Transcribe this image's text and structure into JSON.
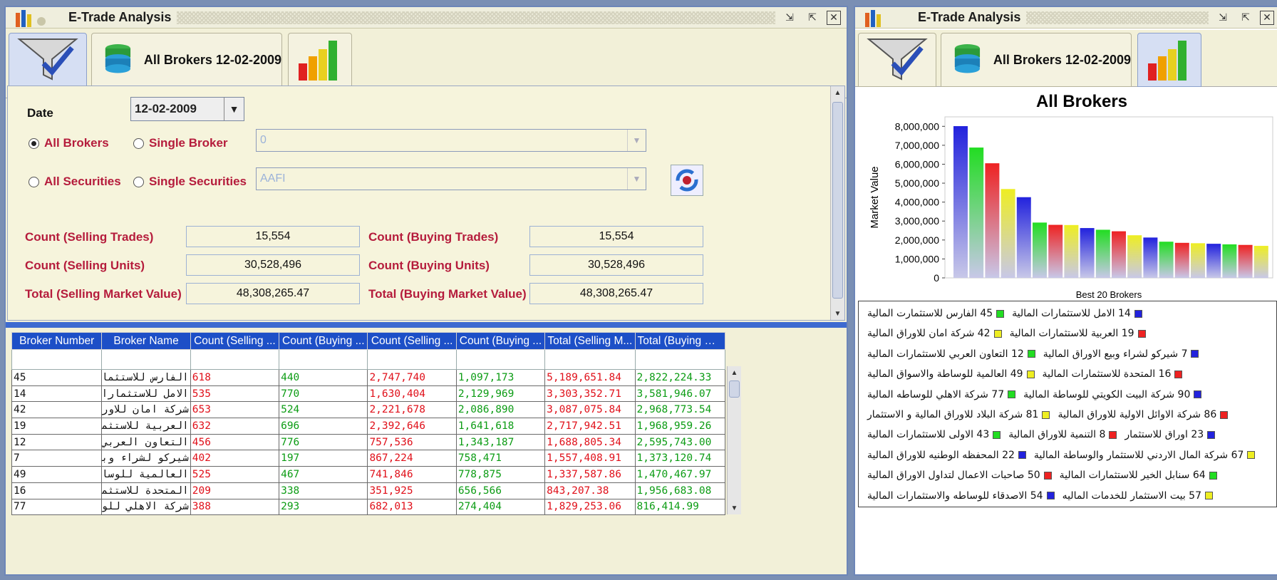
{
  "left_window": {
    "title": "E-Trade Analysis",
    "controls": {
      "minimize": "⇲",
      "maximize": "⇱",
      "close": "✕"
    },
    "tabs": [
      {
        "icon": "filter-icon",
        "label": ""
      },
      {
        "icon": "database-icon",
        "label": "All Brokers  12-02-2009"
      },
      {
        "icon": "bar-chart-icon",
        "label": ""
      }
    ],
    "form": {
      "date_label": "Date",
      "date_value": "12-02-2009",
      "all_brokers": "All Brokers",
      "single_broker": "Single Broker",
      "broker_value": "0",
      "all_securities": "All Securities",
      "single_securities": "Single Securities",
      "security_value": "AAFI"
    },
    "stats": {
      "count_selling_trades_label": "Count (Selling Trades)",
      "count_selling_trades": "15,554",
      "count_buying_trades_label": "Count (Buying Trades)",
      "count_buying_trades": "15,554",
      "count_selling_units_label": "Count (Selling Units)",
      "count_selling_units": "30,528,496",
      "count_buying_units_label": "Count (Buying Units)",
      "count_buying_units": "30,528,496",
      "total_selling_label": "Total (Selling Market Value)",
      "total_selling": "48,308,265.47",
      "total_buying_label": "Total (Buying Market Value)",
      "total_buying": "48,308,265.47"
    },
    "table": {
      "headers": [
        "Broker Number",
        "Broker Name",
        "Count (Selling ...",
        "Count (Buying ...",
        "Count (Selling ...",
        "Count (Buying ...",
        "Total (Selling M...",
        "Total (Buying M..."
      ],
      "rows": [
        [
          "45",
          "الفارس للاستثمارت ...",
          "618",
          "440",
          "2,747,740",
          "1,097,173",
          "5,189,651.84",
          "2,822,224.33"
        ],
        [
          "14",
          "الامل للاستثمارات ...",
          "535",
          "770",
          "1,630,404",
          "2,129,969",
          "3,303,352.71",
          "3,581,946.07"
        ],
        [
          "42",
          "شركة امان للاوراق ...",
          "653",
          "524",
          "2,221,678",
          "2,086,890",
          "3,087,075.84",
          "2,968,773.54"
        ],
        [
          "19",
          "العربية للاستثمارات ...",
          "632",
          "696",
          "2,392,646",
          "1,641,618",
          "2,717,942.51",
          "1,968,959.26"
        ],
        [
          "12",
          "التعاون العربي ...",
          "456",
          "776",
          "757,536",
          "1,343,187",
          "1,688,805.34",
          "2,595,743.00"
        ],
        [
          "7",
          "شيركو لشراء وبيع ...",
          "402",
          "197",
          "867,224",
          "758,471",
          "1,557,408.91",
          "1,373,120.74"
        ],
        [
          "49",
          "العالمية للوساطة ...",
          "525",
          "467",
          "741,846",
          "778,875",
          "1,337,587.86",
          "1,470,467.97"
        ],
        [
          "16",
          "المتحدة للاستثمارات ...",
          "209",
          "338",
          "351,925",
          "656,566",
          "843,207.38",
          "1,956,683.08"
        ],
        [
          "77",
          "شركة الاهلي للوساطه ...",
          "388",
          "293",
          "682,013",
          "274,404",
          "1,829,253.06",
          "816,414.99"
        ]
      ]
    }
  },
  "right_window": {
    "title": "E-Trade Analysis",
    "controls": {
      "minimize": "⇲",
      "maximize": "⇱",
      "close": "✕"
    },
    "tab_label": "All Brokers  12-02-2009",
    "legend": [
      [
        {
          "n": "14 الامل للاستثمارات المالية",
          "c": "#2222dd"
        },
        {
          "n": "45 الفارس للاستثمارت المالية",
          "c": "#22dd22"
        }
      ],
      [
        {
          "n": "19 العربية للاستثمارات المالية",
          "c": "#ee2222"
        },
        {
          "n": "42 شركة امان للاوراق المالية",
          "c": "#eeee22"
        }
      ],
      [
        {
          "n": "7 شيركو لشراء وبيع الاوراق المالية",
          "c": "#2222dd"
        },
        {
          "n": "12 التعاون العربي للاستثمارات المالية",
          "c": "#22dd22"
        }
      ],
      [
        {
          "n": "16 المتحدة للاستثمارات المالية",
          "c": "#ee2222"
        },
        {
          "n": "49 العالمية للوساطة والاسواق المالية",
          "c": "#eeee22"
        }
      ],
      [
        {
          "n": "90 شركة البيت الكويتي للوساطة المالية",
          "c": "#2222dd"
        },
        {
          "n": "77 شركة الاهلي للوساطه المالية",
          "c": "#22dd22"
        }
      ],
      [
        {
          "n": "86 شركة الاوائل الاولية للاوراق المالية",
          "c": "#ee2222"
        },
        {
          "n": "81 شركة البلاد للاوراق المالية و الاستثمار",
          "c": "#eeee22"
        }
      ],
      [
        {
          "n": "23 اوراق للاستثمار",
          "c": "#2222dd"
        },
        {
          "n": "8 التنمية للاوراق المالية",
          "c": "#ee2222"
        },
        {
          "n": "43 الاولى للاستثمارات المالية",
          "c": "#22dd22"
        }
      ],
      [
        {
          "n": "67 شركة المال الاردني للاستثمار والوساطة المالية",
          "c": "#eeee22"
        },
        {
          "n": "22 المحفظه الوطنيه للاوراق المالية",
          "c": "#2222dd"
        }
      ],
      [
        {
          "n": "64 سنابل الخير للاستثمارات المالية",
          "c": "#22dd22"
        },
        {
          "n": "50 صاحبات الاعمال لتداول الاوراق المالية",
          "c": "#ee2222"
        }
      ],
      [
        {
          "n": "57 بيت الاستثمار للخدمات الماليه",
          "c": "#eeee22"
        },
        {
          "n": "54 الاصدقاء للوساطه والاستثمارات المالية",
          "c": "#2222dd"
        }
      ]
    ]
  },
  "chart_data": {
    "type": "bar",
    "title": "All Brokers",
    "xlabel": "Best 20 Brokers",
    "ylabel": "Market Value",
    "ylim": [
      0,
      8500000
    ],
    "yticks": [
      "0",
      "1,000,000",
      "2,000,000",
      "3,000,000",
      "4,000,000",
      "5,000,000",
      "6,000,000",
      "7,000,000",
      "8,000,000"
    ],
    "grid": false,
    "legend_position": "bottom",
    "values": [
      8010000,
      6880000,
      6050000,
      4690000,
      4260000,
      2920000,
      2800000,
      2790000,
      2630000,
      2540000,
      2460000,
      2250000,
      2130000,
      1910000,
      1850000,
      1830000,
      1800000,
      1770000,
      1740000,
      1690000
    ],
    "colors": [
      "#2222dd",
      "#22dd22",
      "#ee2222",
      "#eeee22",
      "#2222dd",
      "#22dd22",
      "#ee2222",
      "#eeee22",
      "#2222dd",
      "#22dd22",
      "#ee2222",
      "#eeee22",
      "#2222dd",
      "#22dd22",
      "#ee2222",
      "#eeee22",
      "#2222dd",
      "#22dd22",
      "#ee2222",
      "#eeee22"
    ]
  }
}
